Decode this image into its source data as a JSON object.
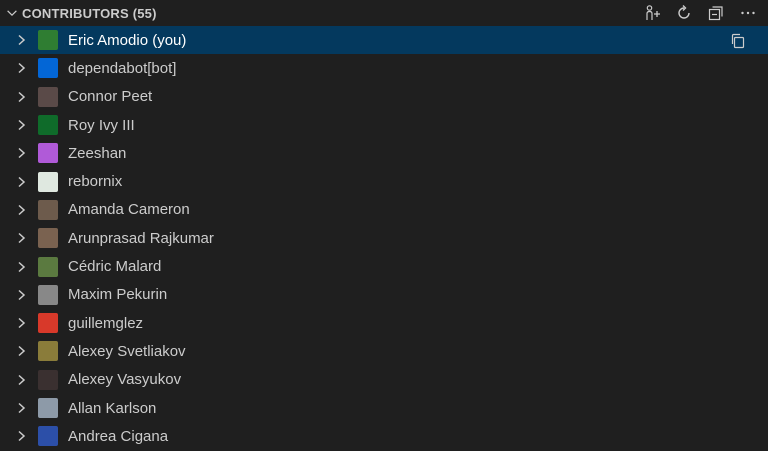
{
  "header": {
    "title": "CONTRIBUTORS (55)",
    "actions": [
      {
        "name": "add-contributor",
        "icon": "person-add-icon"
      },
      {
        "name": "refresh",
        "icon": "refresh-icon"
      },
      {
        "name": "collapse-all",
        "icon": "collapse-all-icon"
      },
      {
        "name": "more-actions",
        "icon": "ellipsis-icon"
      }
    ]
  },
  "contributors": [
    {
      "name": "Eric Amodio (you)",
      "selected": true,
      "avatar_color": "#2f7d32"
    },
    {
      "name": "dependabot[bot]",
      "avatar_color": "#0366d6"
    },
    {
      "name": "Connor Peet",
      "avatar_color": "#5a4a48"
    },
    {
      "name": "Roy Ivy III",
      "avatar_color": "#0f6b2a"
    },
    {
      "name": "Zeeshan",
      "avatar_color": "#b05ad8"
    },
    {
      "name": "rebornix",
      "avatar_color": "#dfe8e0"
    },
    {
      "name": "Amanda Cameron",
      "avatar_color": "#6d5b4c"
    },
    {
      "name": "Arunprasad Rajkumar",
      "avatar_color": "#7a6250"
    },
    {
      "name": "Cédric Malard",
      "avatar_color": "#5b7a40"
    },
    {
      "name": "Maxim Pekurin",
      "avatar_color": "#888888"
    },
    {
      "name": "guillemglez",
      "avatar_color": "#d8392a"
    },
    {
      "name": "Alexey Svetliakov",
      "avatar_color": "#8a7c3a"
    },
    {
      "name": "Alexey Vasyukov",
      "avatar_color": "#3a3030"
    },
    {
      "name": "Allan Karlson",
      "avatar_color": "#8d9aa8"
    },
    {
      "name": "Andrea Cigana",
      "avatar_color": "#2c4fa8"
    }
  ],
  "row_action_icon": "copy-icon"
}
